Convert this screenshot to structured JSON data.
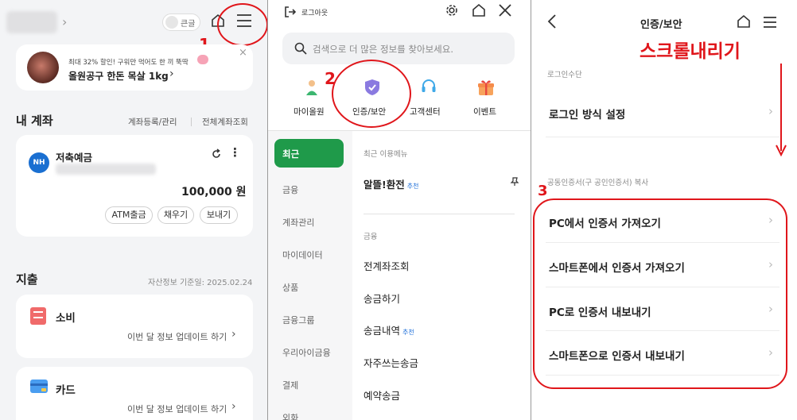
{
  "panel1": {
    "contrast_label": "큰글",
    "promo_line1": "최대 32% 할인! 구워만 먹어도 한 끼 뚝딱",
    "promo_line2": "올원공구 한돈 목살 1kg",
    "promo_close": "×",
    "accounts_title": "내 계좌",
    "accounts_register": "계좌등록/관리",
    "accounts_all": "전체계좌조회",
    "bank_badge": "NH",
    "account_name": "저축예금",
    "balance": "100,000 원",
    "btn_atm": "ATM출금",
    "btn_fill": "채우기",
    "btn_send": "보내기",
    "spending_title": "지출",
    "asset_date": "자산정보 기준일: 2025.02.24",
    "consumption_label": "소비",
    "consumption_update": "이번 달 정보 업데이트 하기",
    "card_label": "카드",
    "card_update": "이번 달 정보 업데이트 하기"
  },
  "panel2": {
    "logout_label": "로그아웃",
    "search_placeholder": "검색으로 더 많은 정보를 찾아보세요.",
    "quick": [
      {
        "label": "마이올원"
      },
      {
        "label": "인증/보안"
      },
      {
        "label": "고객센터"
      },
      {
        "label": "이벤트"
      }
    ],
    "side": [
      "최근",
      "금융",
      "계좌관리",
      "마이데이터",
      "상품",
      "금융그룹",
      "우리아이금융",
      "결제",
      "외화"
    ],
    "recent_header": "최근 이용메뉴",
    "recent_item": "알뜰!환전",
    "badge_recommend": "추천",
    "finance_header": "금융",
    "menu": [
      "전계좌조회",
      "송금하기",
      "송금내역",
      "자주쓰는송금",
      "예약송금"
    ]
  },
  "panel3": {
    "title": "인증/보안",
    "scroll_note": "스크롤내리기",
    "login_section": "로그인수단",
    "login_setting": "로그인 방식 설정",
    "cert_section": "공동인증서(구 공인인증서) 복사",
    "cert_items": [
      "PC에서 인증서 가져오기",
      "스마트폰에서 인증서 가져오기",
      "PC로 인증서 내보내기",
      "스마트폰으로 인증서 내보내기"
    ]
  },
  "annotations": {
    "step1": "1",
    "step2": "2",
    "step3": "3"
  },
  "colors": {
    "accent_green": "#1f9a4a",
    "annotation_red": "#e0161b",
    "nh_blue": "#1a6fd1",
    "recommend_blue": "#1e6fd9",
    "shield_purple": "#8a7ae0"
  }
}
